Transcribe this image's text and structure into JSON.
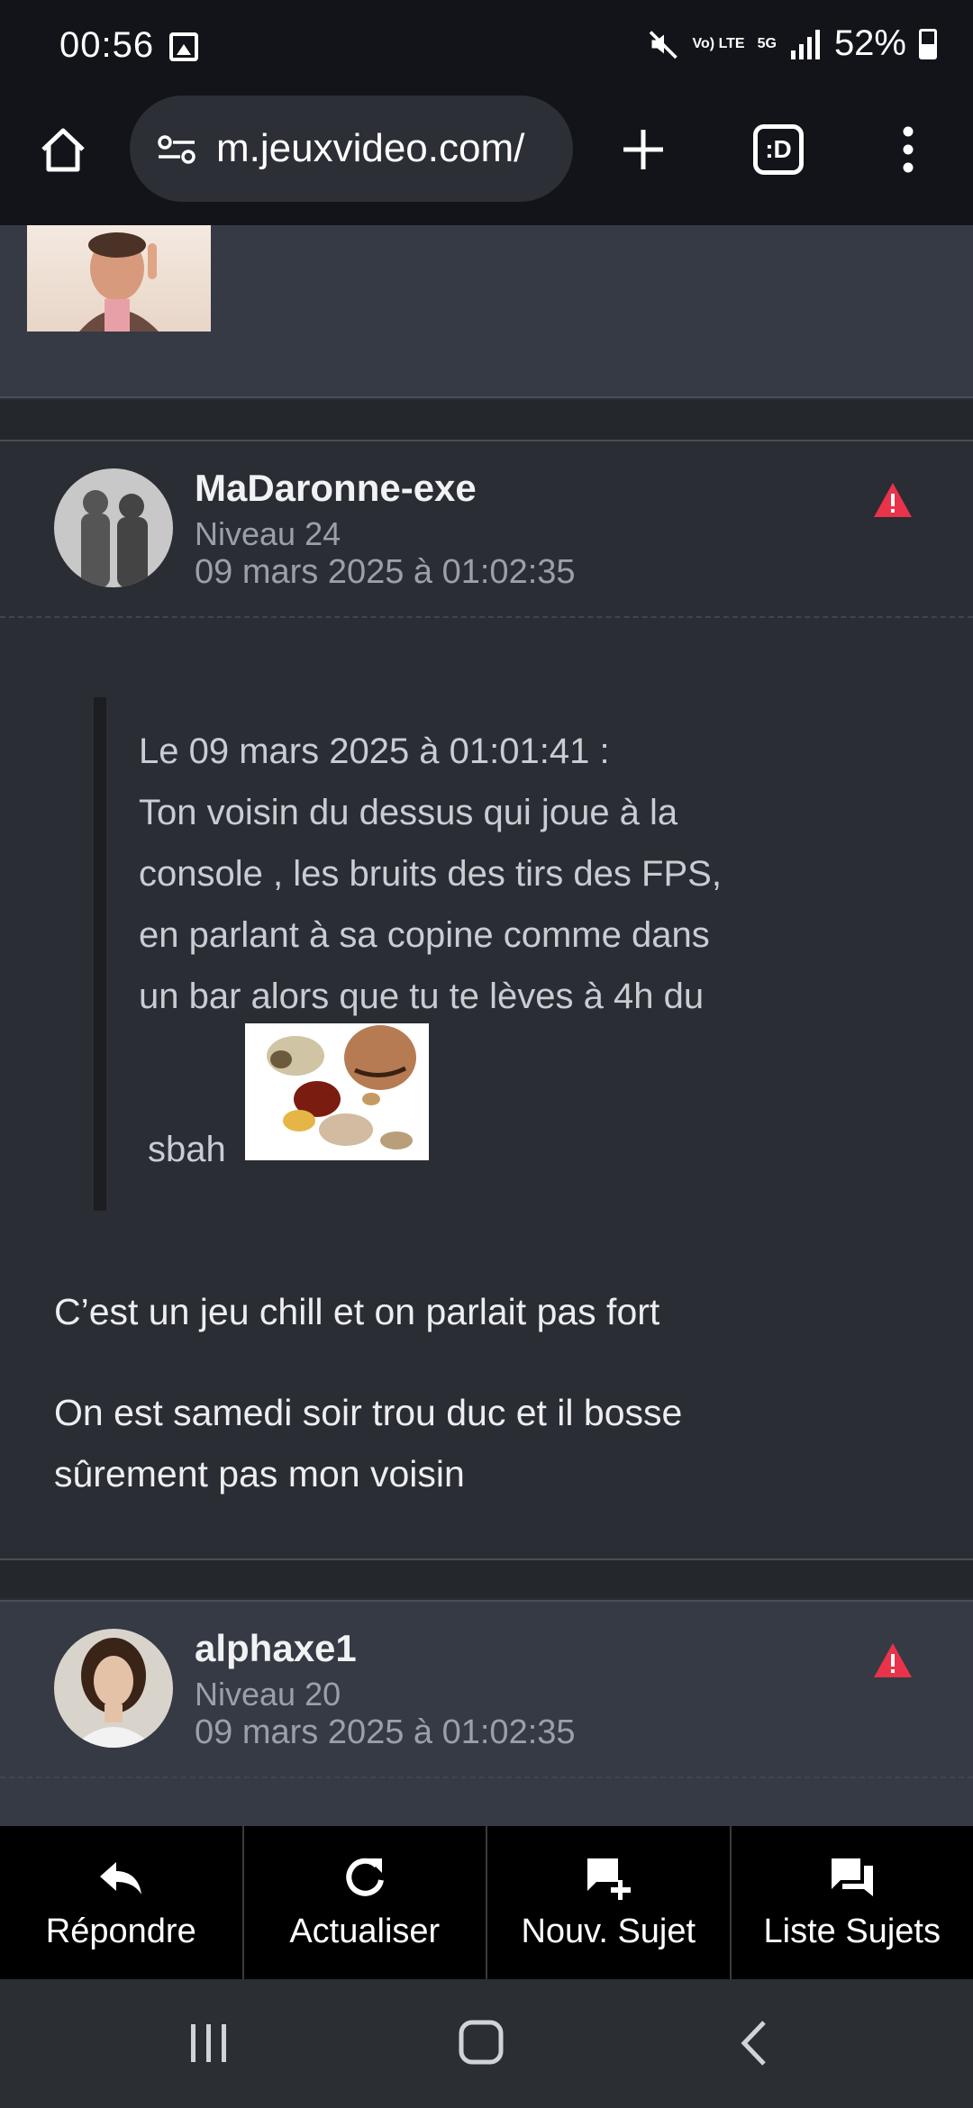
{
  "status": {
    "time": "00:56",
    "volte": "Vo) LTE",
    "net": "5G",
    "battery": "52%"
  },
  "browser": {
    "url": "m.jeuxvideo.com/",
    "tab_count": ":D"
  },
  "posts": [
    {
      "author": "MaDaronne-exe",
      "level": "Niveau 24",
      "date": "09 mars 2025 à 01:02:35",
      "quote": {
        "header": "Le 09 mars 2025 à 01:01:41 :",
        "lines": [
          "Ton voisin du dessus qui joue à la",
          "console , les bruits des tirs des FPS,",
          "en parlant à sa copine comme dans",
          "un bar alors que tu te lèves à 4h du"
        ],
        "last_word": "sbah"
      },
      "message": [
        "C’est un jeu chill et on parlait pas fort",
        "On est samedi soir trou duc et il bosse",
        "sûrement pas mon voisin"
      ]
    },
    {
      "author": "alphaxe1",
      "level": "Niveau 20",
      "date": "09 mars 2025 à 01:02:35"
    }
  ],
  "bottom_bar": {
    "reply": "Répondre",
    "refresh": "Actualiser",
    "new_topic": "Nouv. Sujet",
    "topic_list": "Liste Sujets"
  },
  "colors": {
    "warning": "#e8334a",
    "background": "#2a2d33",
    "header": "#353a44"
  }
}
